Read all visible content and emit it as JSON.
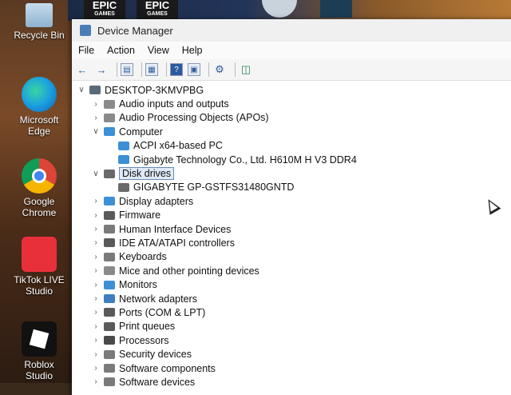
{
  "taskbar_apps": [
    {
      "name": "EPIC",
      "sub": "GAMES"
    },
    {
      "name": "EPIC",
      "sub": "GAMES"
    }
  ],
  "desktop_icons": [
    {
      "label": "Recycle Bin",
      "icon": "recycle-bin-icon"
    },
    {
      "label": "Microsoft Edge",
      "icon": "edge-icon"
    },
    {
      "label": "Google Chrome",
      "icon": "chrome-icon"
    },
    {
      "label": "TikTok LIVE Studio",
      "icon": "tiktok-icon"
    },
    {
      "label": "Roblox Studio",
      "icon": "roblox-icon"
    }
  ],
  "window": {
    "title": "Device Manager",
    "menu": [
      "File",
      "Action",
      "View",
      "Help"
    ]
  },
  "toolbar_icons": [
    "back-arrow-icon",
    "forward-arrow-icon",
    "properties-icon",
    "update-driver-icon",
    "help-icon",
    "view-icon",
    "scan-hardware-icon",
    "monitor-icon"
  ],
  "tree": {
    "root": "DESKTOP-3KMVPBG",
    "items": [
      {
        "label": "Audio inputs and outputs",
        "level": 1,
        "expanded": false,
        "color": "#8a8a8a"
      },
      {
        "label": "Audio Processing Objects (APOs)",
        "level": 1,
        "expanded": false,
        "color": "#8a8a8a"
      },
      {
        "label": "Computer",
        "level": 1,
        "expanded": true,
        "color": "#3d8fd6"
      },
      {
        "label": "ACPI x64-based PC",
        "level": 2,
        "color": "#3d8fd6"
      },
      {
        "label": "Gigabyte Technology Co., Ltd. H610M H V3 DDR4",
        "level": 2,
        "color": "#3d8fd6"
      },
      {
        "label": "Disk drives",
        "level": 1,
        "expanded": true,
        "selected": true,
        "color": "#6a6a6a"
      },
      {
        "label": "GIGABYTE GP-GSTFS31480GNTD",
        "level": 2,
        "color": "#6a6a6a"
      },
      {
        "label": "Display adapters",
        "level": 1,
        "expanded": false,
        "color": "#3d8fd6"
      },
      {
        "label": "Firmware",
        "level": 1,
        "expanded": false,
        "color": "#5a5a5a"
      },
      {
        "label": "Human Interface Devices",
        "level": 1,
        "expanded": false,
        "color": "#7a7a7a"
      },
      {
        "label": "IDE ATA/ATAPI controllers",
        "level": 1,
        "expanded": false,
        "color": "#5a5a5a"
      },
      {
        "label": "Keyboards",
        "level": 1,
        "expanded": false,
        "color": "#7a7a7a"
      },
      {
        "label": "Mice and other pointing devices",
        "level": 1,
        "expanded": false,
        "color": "#8a8a8a"
      },
      {
        "label": "Monitors",
        "level": 1,
        "expanded": false,
        "color": "#3d8fd6"
      },
      {
        "label": "Network adapters",
        "level": 1,
        "expanded": false,
        "color": "#3d7fc0"
      },
      {
        "label": "Ports (COM & LPT)",
        "level": 1,
        "expanded": false,
        "color": "#5a5a5a"
      },
      {
        "label": "Print queues",
        "level": 1,
        "expanded": false,
        "color": "#5a5a5a"
      },
      {
        "label": "Processors",
        "level": 1,
        "expanded": false,
        "color": "#4a4a4a"
      },
      {
        "label": "Security devices",
        "level": 1,
        "expanded": false,
        "color": "#7a7a7a"
      },
      {
        "label": "Software components",
        "level": 1,
        "expanded": false,
        "color": "#7a7a7a"
      },
      {
        "label": "Software devices",
        "level": 1,
        "expanded": false,
        "color": "#7a7a7a"
      }
    ]
  }
}
